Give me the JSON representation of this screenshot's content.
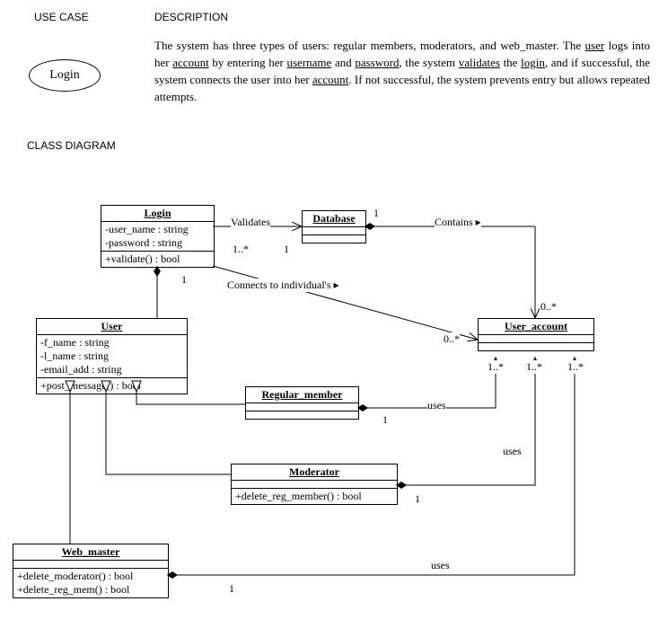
{
  "section_labels": {
    "use_case": "USE CASE",
    "description": "DESCRIPTION",
    "class_diagram": "CLASS DIAGRAM"
  },
  "use_case_name": "Login",
  "description_parts": [
    "The system has three types of users: regular members, moderators, and web_master. The ",
    "user",
    " logs into her ",
    "account",
    " by entering her ",
    "username",
    " and ",
    "password",
    ", the system ",
    "validates",
    " the ",
    "login",
    ", and if successful, the system connects the user into her ",
    "account",
    ". If not successful, the system prevents entry but allows repeated attempts."
  ],
  "classes": {
    "login": {
      "name": "Login",
      "attrs": [
        "-user_name : string",
        "-password : string"
      ],
      "ops": [
        "+validate() : bool"
      ]
    },
    "database": {
      "name": "Database",
      "attrs": [],
      "ops": []
    },
    "user": {
      "name": "User",
      "attrs": [
        "-f_name : string",
        "-l_name : string",
        "-email_add : string"
      ],
      "ops": [
        "+post_message() : bool"
      ]
    },
    "user_account": {
      "name": "User_account",
      "attrs": [],
      "ops": []
    },
    "regular_member": {
      "name": "Regular_member",
      "attrs": [],
      "ops": []
    },
    "moderator": {
      "name": "Moderator",
      "attrs": [],
      "ops": [
        "+delete_reg_member() : bool"
      ]
    },
    "web_master": {
      "name": "Web_master",
      "attrs": [],
      "ops": [
        "+delete_moderator() : bool",
        "+delete_reg_mem() : bool"
      ]
    }
  },
  "rel_labels": {
    "validates": "Validates",
    "contains": "Contains ▸",
    "connects": "Connects to individual's ▸",
    "uses": "uses"
  },
  "multiplicities": {
    "one": "1",
    "one_many": "1..*",
    "zero_many": "0..*"
  }
}
